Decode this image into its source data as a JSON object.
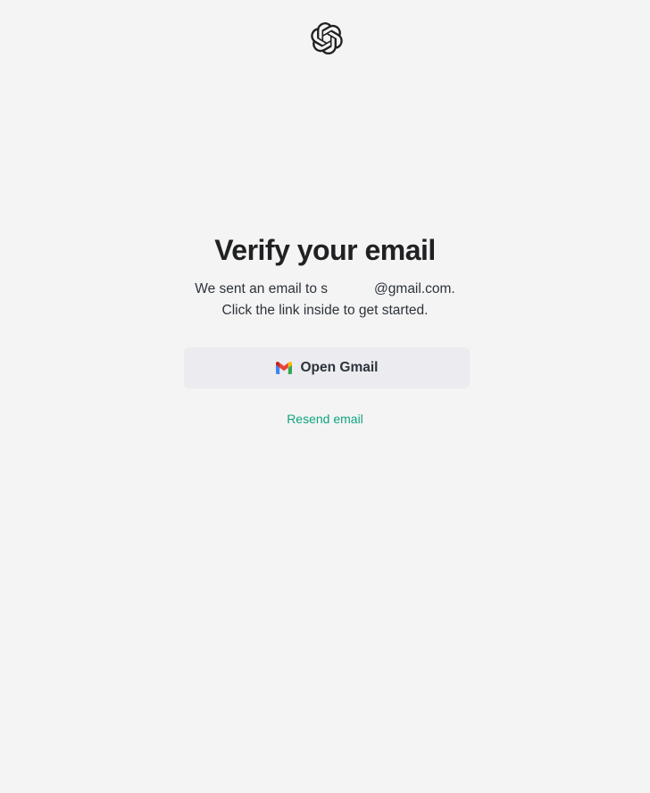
{
  "brand": {
    "logo_icon": "openai-logo-icon",
    "logo_color": "#202123"
  },
  "main": {
    "title": "Verify your email",
    "description": {
      "email_prefix": "We sent an email to s",
      "email_suffix": "@gmail.com.",
      "line2": "Click the link inside to get started."
    }
  },
  "actions": {
    "open_gmail_label": "Open Gmail",
    "gmail_icon": "gmail-icon",
    "resend_label": "Resend email"
  },
  "colors": {
    "background": "#f4f4f4",
    "button_bg": "#ebebf0",
    "accent": "#10a37f",
    "text": "#2d333a"
  }
}
